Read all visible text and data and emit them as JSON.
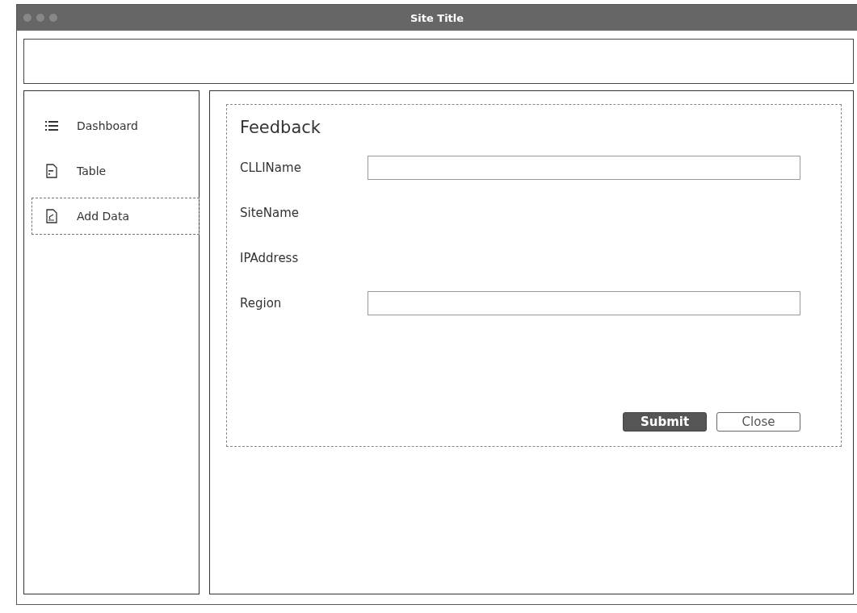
{
  "window": {
    "title": "Site Title"
  },
  "sidebar": {
    "items": [
      {
        "label": "Dashboard",
        "kind": "list",
        "selected": false
      },
      {
        "label": "Table",
        "kind": "doc",
        "selected": false
      },
      {
        "label": "Add Data",
        "kind": "edit",
        "selected": true
      }
    ]
  },
  "form": {
    "title": "Feedback",
    "fields": [
      {
        "label": "CLLIName",
        "kind": "input"
      },
      {
        "label": "SiteName",
        "kind": "label"
      },
      {
        "label": "IPAddress",
        "kind": "label"
      },
      {
        "label": "Region",
        "kind": "input"
      }
    ],
    "buttons": [
      {
        "label": "Submit",
        "kind": "primary"
      },
      {
        "label": "Close",
        "kind": "secondary"
      }
    ]
  }
}
